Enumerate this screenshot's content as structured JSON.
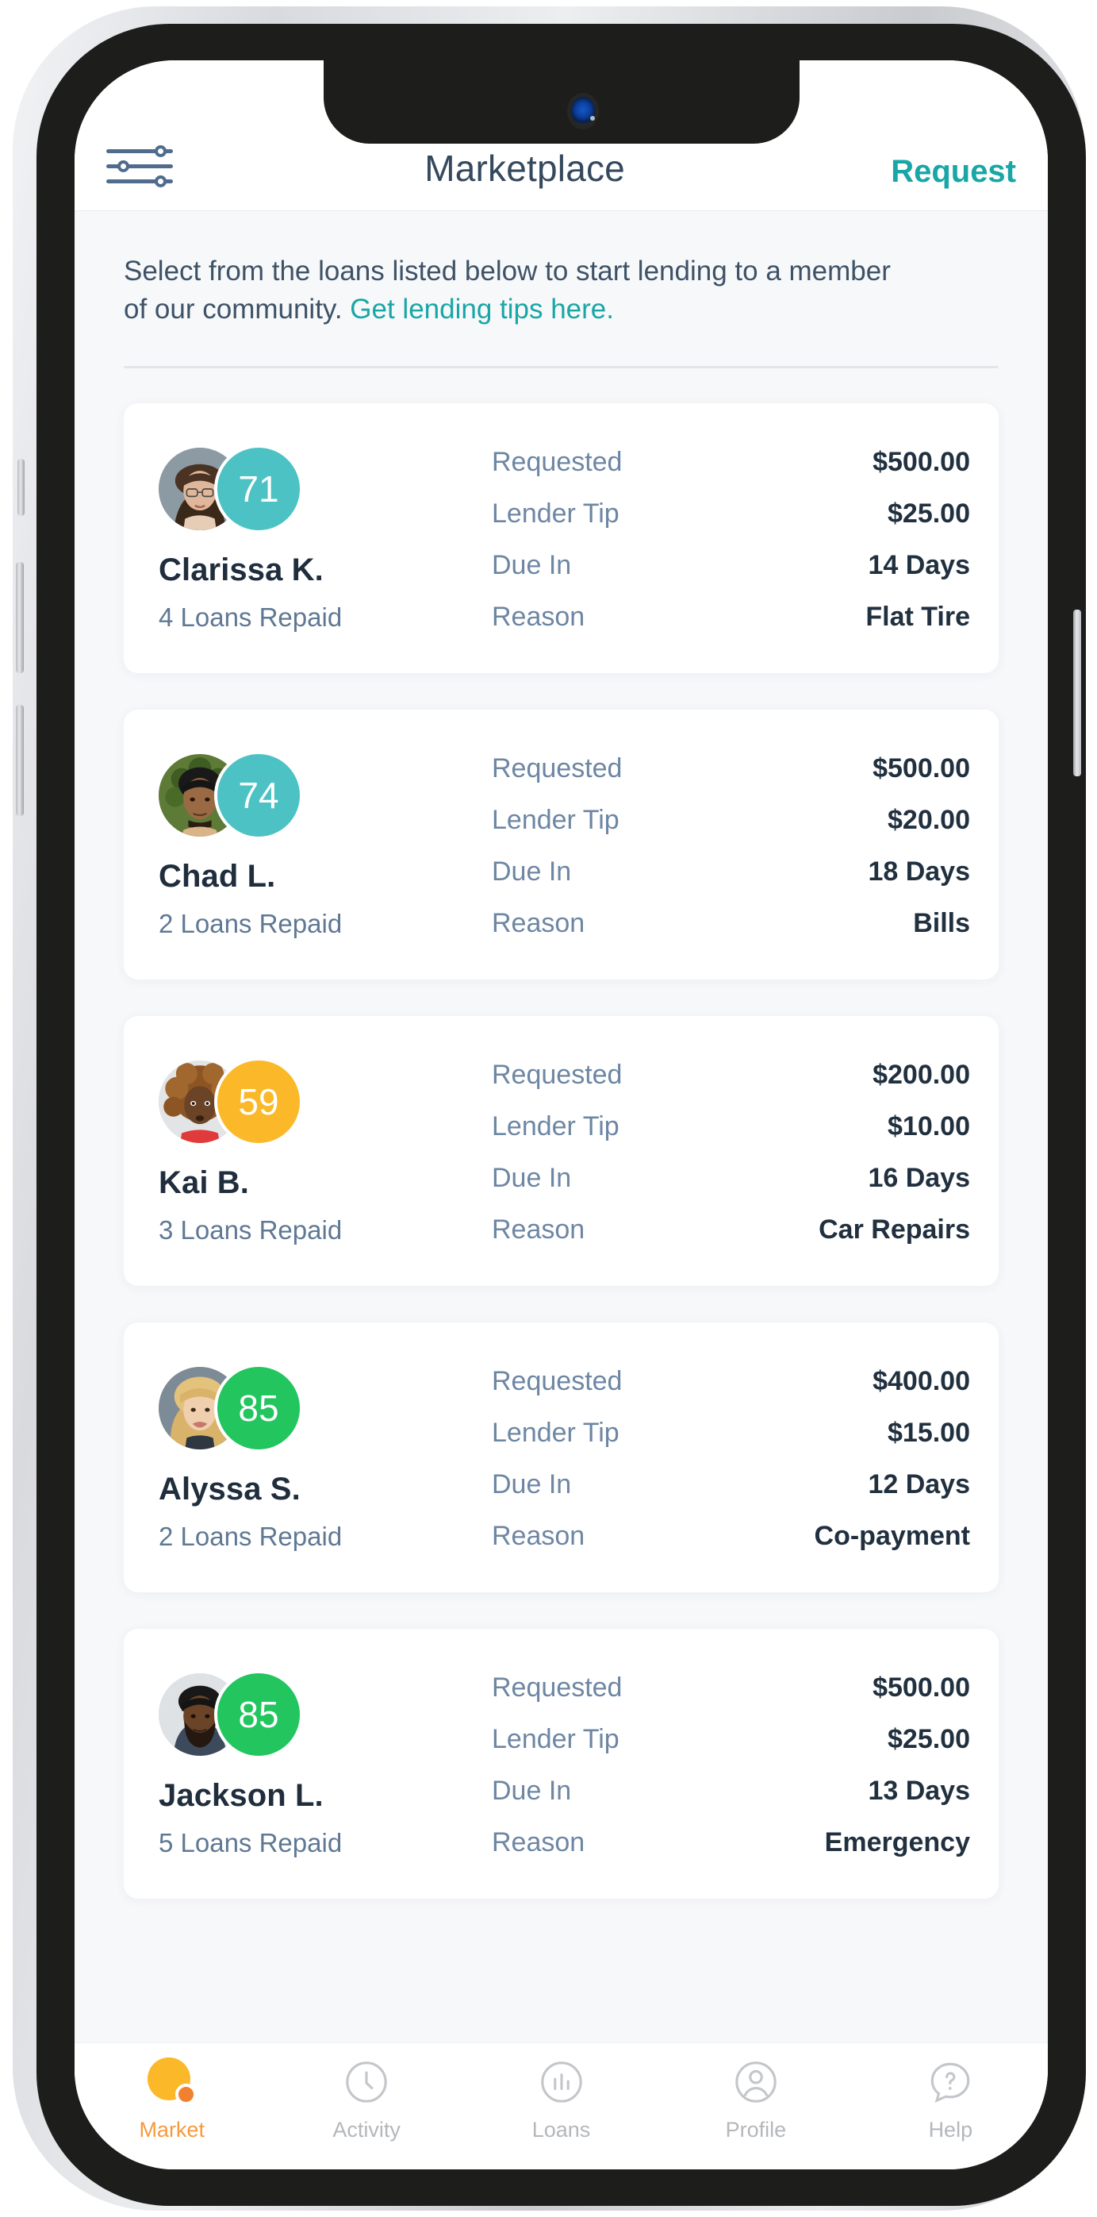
{
  "header": {
    "filter_icon": "filter-sliders-icon",
    "title": "Marketplace",
    "request_label": "Request"
  },
  "intro": {
    "text_before": "Select from the loans listed below to start lending to a member of our community. ",
    "link_text": "Get lending tips here."
  },
  "colors": {
    "teal": "#19a6a6",
    "score_teal": "#4cc2c4",
    "score_amber": "#fbb829",
    "score_green": "#22c55e",
    "accent_orange": "#f79a3c",
    "label_blue": "#6d86a3",
    "value_dark": "#21303f",
    "page_bg": "#f7f8fa"
  },
  "loans": [
    {
      "name": "Clarissa K.",
      "score": "71",
      "score_color": "#4cc2c4",
      "repaid": "4 Loans Repaid",
      "avatar": "avatar-woman-glasses",
      "details": [
        {
          "label": "Requested",
          "value": "$500.00"
        },
        {
          "label": "Lender Tip",
          "value": "$25.00"
        },
        {
          "label": "Due In",
          "value": "14 Days"
        },
        {
          "label": "Reason",
          "value": "Flat Tire"
        }
      ]
    },
    {
      "name": "Chad L.",
      "score": "74",
      "score_color": "#4cc2c4",
      "repaid": "2 Loans Repaid",
      "avatar": "avatar-man-curly",
      "details": [
        {
          "label": "Requested",
          "value": "$500.00"
        },
        {
          "label": "Lender Tip",
          "value": "$20.00"
        },
        {
          "label": "Due In",
          "value": "18 Days"
        },
        {
          "label": "Reason",
          "value": "Bills"
        }
      ]
    },
    {
      "name": "Kai B.",
      "score": "59",
      "score_color": "#fbb829",
      "repaid": "3 Loans Repaid",
      "avatar": "avatar-woman-afro",
      "details": [
        {
          "label": "Requested",
          "value": "$200.00"
        },
        {
          "label": "Lender Tip",
          "value": "$10.00"
        },
        {
          "label": "Due In",
          "value": "16  Days"
        },
        {
          "label": "Reason",
          "value": "Car Repairs"
        }
      ]
    },
    {
      "name": "Alyssa S.",
      "score": "85",
      "score_color": "#22c55e",
      "repaid": "2 Loans Repaid",
      "avatar": "avatar-woman-blonde",
      "details": [
        {
          "label": "Requested",
          "value": "$400.00"
        },
        {
          "label": "Lender Tip",
          "value": "$15.00"
        },
        {
          "label": "Due In",
          "value": "12 Days"
        },
        {
          "label": "Reason",
          "value": "Co-payment"
        }
      ]
    },
    {
      "name": "Jackson L.",
      "score": "85",
      "score_color": "#22c55e",
      "repaid": "5 Loans Repaid",
      "avatar": "avatar-man-beard",
      "details": [
        {
          "label": "Requested",
          "value": "$500.00"
        },
        {
          "label": "Lender Tip",
          "value": "$25.00"
        },
        {
          "label": "Due In",
          "value": "13 Days"
        },
        {
          "label": "Reason",
          "value": "Emergency"
        }
      ]
    }
  ],
  "tabs": [
    {
      "label": "Market",
      "icon": "market-pie-icon",
      "active": true
    },
    {
      "label": "Activity",
      "icon": "clock-icon",
      "active": false
    },
    {
      "label": "Loans",
      "icon": "bar-chart-icon",
      "active": false
    },
    {
      "label": "Profile",
      "icon": "person-icon",
      "active": false
    },
    {
      "label": "Help",
      "icon": "question-chat-icon",
      "active": false
    }
  ]
}
